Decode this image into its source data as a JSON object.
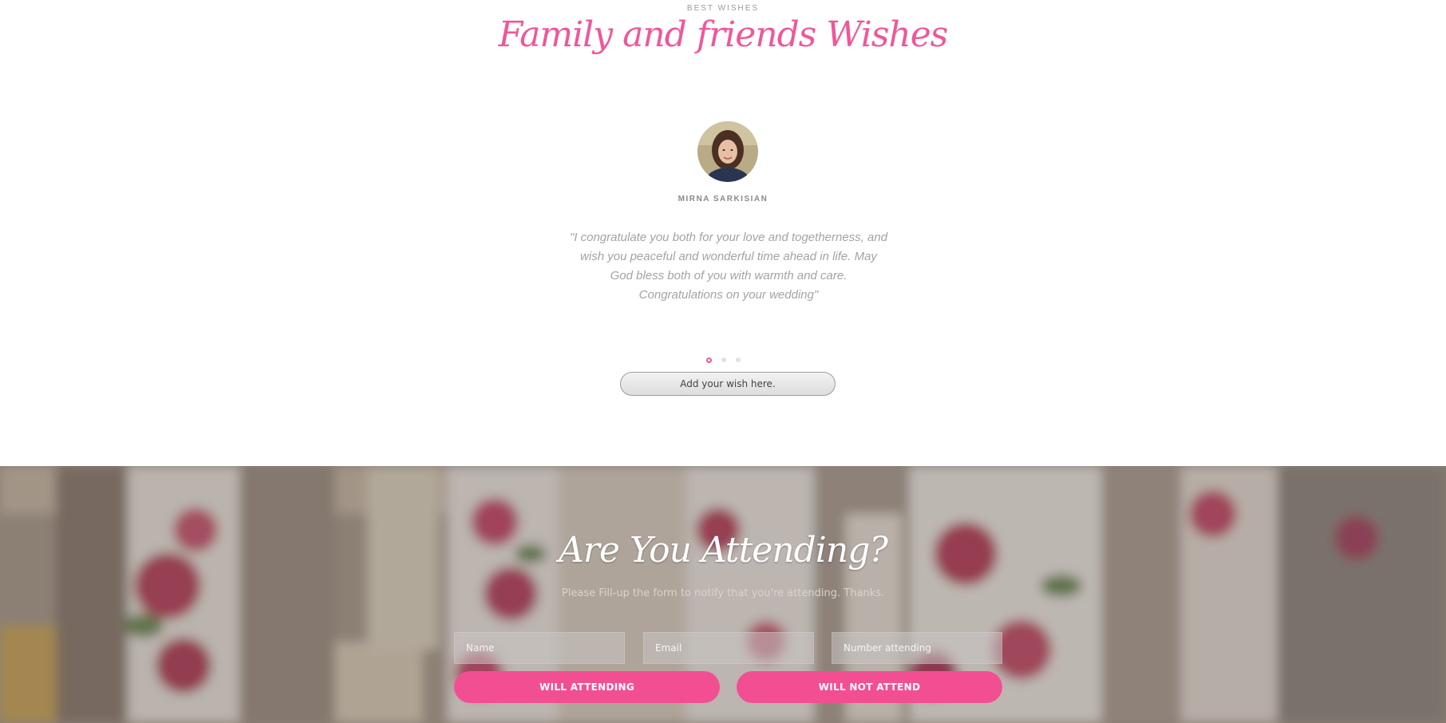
{
  "wishes": {
    "eyebrow": "BEST WISHES",
    "title": "Family and friends Wishes",
    "testimonial": {
      "author": "MIRNA SARKISIAN",
      "quote": "\"I congratulate you both for your love and togetherness, and wish you peaceful and wonderful time ahead in life. May God bless both of you with warmth and care. Congratulations on your wedding\""
    },
    "carousel": {
      "count": 3,
      "active_index": 0
    },
    "add_wish_label": "Add your wish here."
  },
  "rsvp": {
    "title": "Are You Attending?",
    "subtitle": "Please Fill-up the form to notify that you're attending. Thanks.",
    "fields": {
      "name_placeholder": "Name",
      "email_placeholder": "Email",
      "number_placeholder": "Number attending"
    },
    "attend_label": "WILL ATTENDING",
    "not_attend_label": "WILL NOT ATTEND"
  },
  "colors": {
    "accent": "#f0569a",
    "button": "#f24f92",
    "muted_text": "#a3a3a3"
  }
}
